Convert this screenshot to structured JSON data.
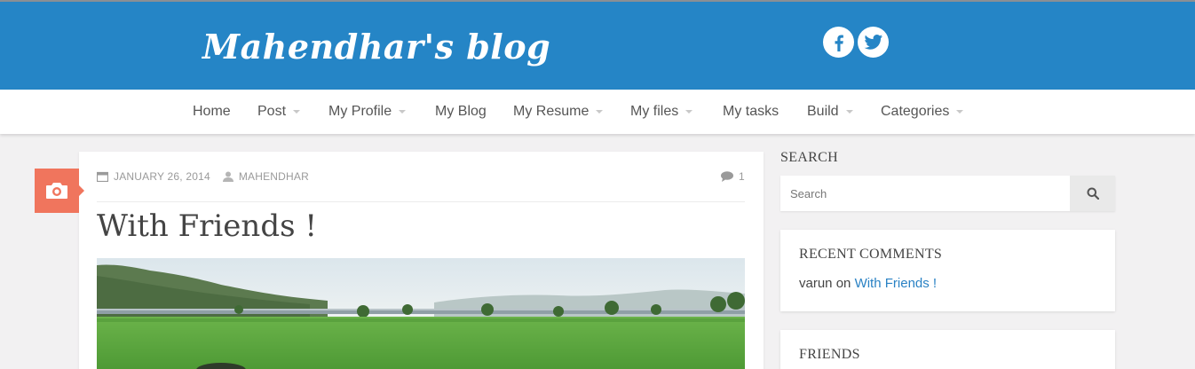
{
  "header": {
    "logo": "Mahendhar's blog",
    "social": [
      {
        "icon": "facebook-icon",
        "color": "#2585c6"
      },
      {
        "icon": "twitter-icon",
        "color": "#2585c6"
      }
    ],
    "brand_color": "#2585c6"
  },
  "nav": {
    "items": [
      {
        "label": "Home",
        "has_dropdown": false
      },
      {
        "label": "Post",
        "has_dropdown": true
      },
      {
        "label": "My Profile",
        "has_dropdown": true
      },
      {
        "label": "My Blog",
        "has_dropdown": false
      },
      {
        "label": "My Resume",
        "has_dropdown": true
      },
      {
        "label": "My files",
        "has_dropdown": true
      },
      {
        "label": "My tasks",
        "has_dropdown": false
      },
      {
        "label": "Build",
        "has_dropdown": true
      },
      {
        "label": "Categories",
        "has_dropdown": true
      }
    ]
  },
  "post": {
    "format_icon": "camera-icon",
    "format_color": "#f0755d",
    "date": "JANUARY 26, 2014",
    "author": "MAHENDHAR",
    "comment_count": "1",
    "title": "With Friends !"
  },
  "sidebar": {
    "search": {
      "title": "SEARCH",
      "placeholder": "Search"
    },
    "recent_comments": {
      "title": "RECENT COMMENTS",
      "author": "varun",
      "connector": "on",
      "post_link": "With Friends !",
      "link_color": "#2a82c4"
    },
    "friends": {
      "title": "FRIENDS"
    }
  }
}
